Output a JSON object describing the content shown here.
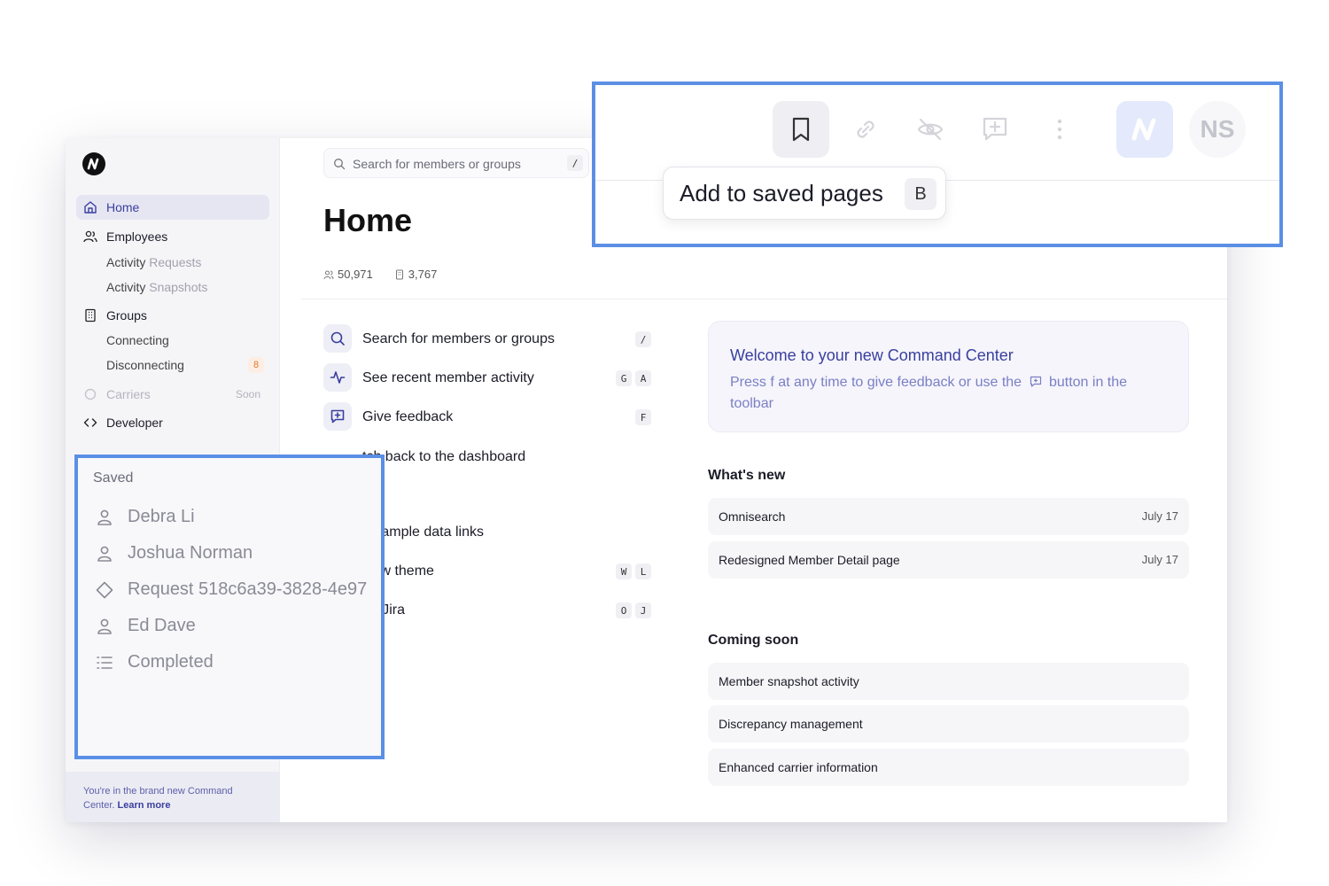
{
  "sidebar": {
    "logo": "command-center-logo",
    "items": [
      {
        "label": "Home",
        "icon": "home-icon",
        "active": true
      },
      {
        "label": "Employees",
        "icon": "users-icon"
      },
      {
        "label": "Groups",
        "icon": "building-icon"
      },
      {
        "label": "Carriers",
        "icon": "circle-icon",
        "tag": "Soon"
      },
      {
        "label": "Developer",
        "icon": "code-icon"
      }
    ],
    "employees_sub": [
      {
        "label_a": "Activity",
        "label_b": " Requests"
      },
      {
        "label_a": "Activity",
        "label_b": " Snapshots"
      }
    ],
    "groups_sub": [
      {
        "label": "Connecting"
      },
      {
        "label": "Disconnecting",
        "badge": "8"
      }
    ],
    "footer": {
      "text": "You're in the brand new Command Center.",
      "link": "Learn more"
    }
  },
  "search": {
    "placeholder": "Search for members or groups",
    "shortcut": "/"
  },
  "page": {
    "title": "Home",
    "stats": [
      {
        "icon": "people-icon",
        "value": "50,971"
      },
      {
        "icon": "building-icon",
        "value": "3,767"
      }
    ]
  },
  "actions": [
    {
      "label": "Search for members or groups",
      "icon": "search-icon",
      "keys": [
        "/"
      ]
    },
    {
      "label": "See recent member activity",
      "icon": "activity-icon",
      "keys": [
        "G",
        "A"
      ]
    },
    {
      "label": "Give feedback",
      "icon": "feedback-icon",
      "keys": [
        "F"
      ]
    },
    {
      "label": "tch back to the dashboard",
      "icon": "",
      "keys": []
    },
    {
      "label": "d sample data links",
      "icon": "",
      "keys": []
    },
    {
      "label": "view theme",
      "icon": "",
      "keys": [
        "W",
        "L"
      ]
    },
    {
      "label": "en Jira",
      "icon": "",
      "keys": [
        "O",
        "J"
      ]
    }
  ],
  "welcome": {
    "title": "Welcome to your new Command Center",
    "body_pre": "Press f at any time to give feedback or use the",
    "body_post": "button in the toolbar"
  },
  "whats_new": {
    "title": "What's new",
    "items": [
      {
        "label": "Omnisearch",
        "date": "July 17"
      },
      {
        "label": "Redesigned Member Detail page",
        "date": "July 17"
      }
    ]
  },
  "coming_soon": {
    "title": "Coming soon",
    "items": [
      {
        "label": "Member snapshot activity"
      },
      {
        "label": "Discrepancy management"
      },
      {
        "label": "Enhanced carrier information"
      }
    ]
  },
  "toolbar": {
    "buttons": [
      "bookmark-icon",
      "link-icon",
      "eye-off-icon",
      "feedback-icon",
      "more-vertical-icon"
    ],
    "tooltip": {
      "label": "Add to saved pages",
      "key": "B"
    },
    "avatar": "NS"
  },
  "saved": {
    "title": "Saved",
    "items": [
      {
        "label": "Debra Li",
        "icon": "person-icon"
      },
      {
        "label": "Joshua Norman",
        "icon": "person-icon"
      },
      {
        "label": "Request 518c6a39-3828-4e97",
        "icon": "diamond-icon"
      },
      {
        "label": "Ed Dave",
        "icon": "person-icon"
      },
      {
        "label": "Completed",
        "icon": "list-icon"
      }
    ]
  },
  "colors": {
    "accent": "#3a3f9e",
    "highlight": "#5b8fe5",
    "badge": "#e07a35"
  }
}
